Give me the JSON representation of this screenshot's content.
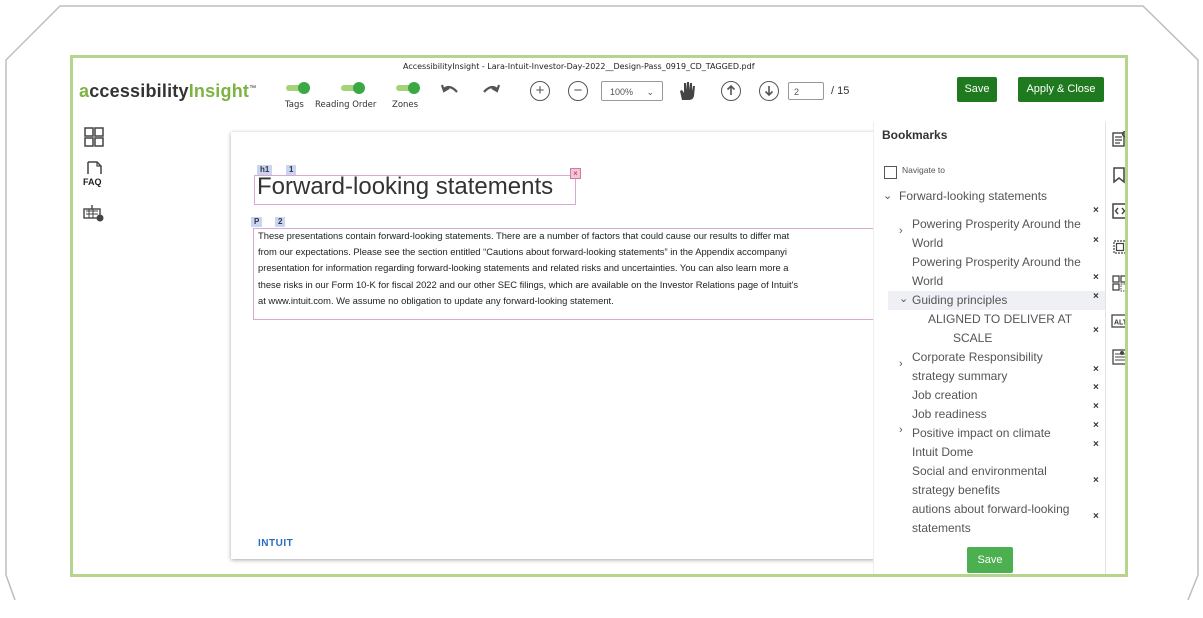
{
  "app": {
    "logo": {
      "part_a": "a",
      "part_cc": "ccessibility",
      "part_insight": "Insight",
      "tm": "™"
    },
    "document_title": "AccessibilityInsight - Lara-Intuit-Investor-Day-2022__Design-Pass_0919_CD_TAGGED.pdf"
  },
  "toolbar": {
    "toggles": [
      {
        "label": "Tags",
        "on": true
      },
      {
        "label": "Reading Order",
        "on": true
      },
      {
        "label": "Zones",
        "on": true
      }
    ],
    "zoom_value": "100%",
    "page_current": "2",
    "page_total": "/ 15",
    "save_label": "Save",
    "apply_close_label": "Apply & Close"
  },
  "document": {
    "h1_tag": "h1",
    "h1_order": "1",
    "heading": "Forward-looking statements",
    "p_tag": "P",
    "p_order": "2",
    "paragraph_lines": [
      "These presentations contain forward-looking statements. There are a number of factors that could cause our results to differ mat",
      "from our expectations. Please see the section entitled “Cautions about forward-looking statements” in the Appendix accompanyi",
      "presentation for information regarding forward-looking statements and related risks and uncertainties. You can also learn more a",
      "these risks in our Form 10-K for fiscal 2022 and our other SEC filings, which are available on the Investor Relations page of Intuit's",
      "at www.intuit.com. We assume no obligation to update any forward-looking statement."
    ],
    "footer_logo": "INTUIT"
  },
  "bookmarks": {
    "title": "Bookmarks",
    "navigate_label": "Navigate to",
    "root": "Forward-looking statements",
    "items": [
      {
        "line1": "Powering Prosperity Around the",
        "line2": "World"
      },
      {
        "line1": "Powering Prosperity Around the",
        "line2": "World"
      },
      {
        "line1": "Guiding principles"
      },
      {
        "line1": "ALIGNED TO DELIVER AT",
        "line2": "SCALE"
      },
      {
        "line1": "Corporate Responsibility",
        "line2": "strategy summary"
      },
      {
        "line1": "Job creation"
      },
      {
        "line1": "Job readiness"
      },
      {
        "line1": "Positive impact on climate"
      },
      {
        "line1": "Intuit Dome"
      },
      {
        "line1": "Social and environmental",
        "line2": "strategy benefits"
      },
      {
        "line1": "autions about forward-looking",
        "line2": "statements"
      }
    ],
    "remove_glyph": "×",
    "save_label": "Save"
  },
  "left_tools": {
    "faq_label": "FAQ"
  },
  "right_tools": {
    "alt_label": "ALT"
  },
  "colors": {
    "accent_green": "#3aa843",
    "button_green": "#1f7a1f",
    "border_green": "#b7d48f",
    "tag_blue": "#c9d6f2"
  }
}
